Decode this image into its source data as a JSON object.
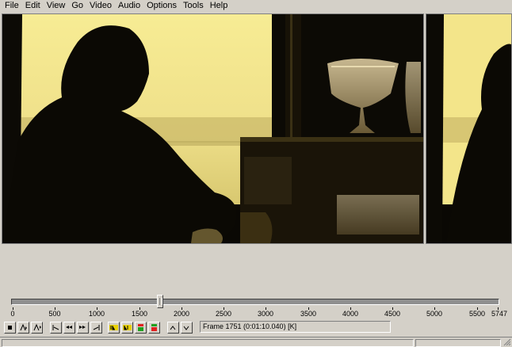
{
  "menu": [
    "File",
    "Edit",
    "View",
    "Go",
    "Video",
    "Audio",
    "Options",
    "Tools",
    "Help"
  ],
  "timeline": {
    "ticks": [
      "0",
      "500",
      "1000",
      "1500",
      "2000",
      "2500",
      "3000",
      "3500",
      "4000",
      "4500",
      "5000",
      "5500",
      "5747"
    ],
    "max_frame": 5747,
    "current_frame": 1751
  },
  "toolbar": {
    "buttons": [
      "stop-icon",
      "play-input-icon",
      "play-output-icon",
      "go-start-icon",
      "prev-keyframe-icon",
      "next-keyframe-icon",
      "go-end-icon",
      "mark-in-icon",
      "mark-out-icon",
      "scene-prev-icon",
      "scene-next-icon",
      "prev-frame-icon",
      "next-frame-icon"
    ],
    "frame_text": "Frame 1751 (0:01:10.040) [K]"
  },
  "colors": {
    "sky": "#f3e58a",
    "haze": "#c9b968",
    "silhouette": "#0b0904",
    "piano": "#1a1408"
  }
}
